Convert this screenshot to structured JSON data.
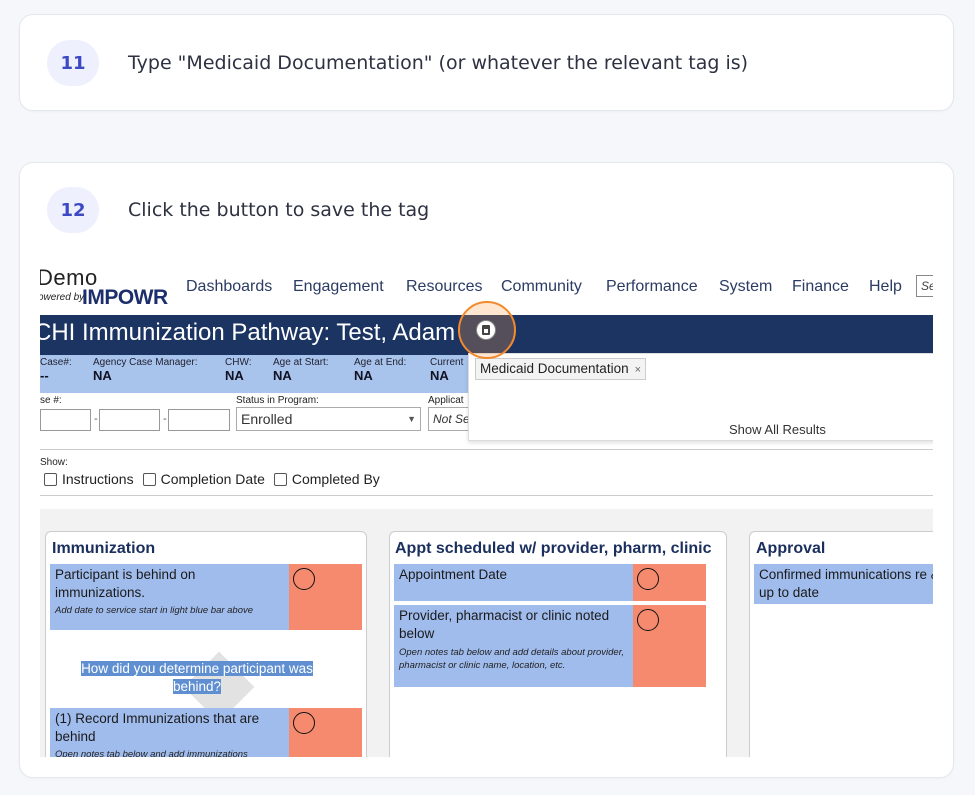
{
  "steps": [
    {
      "number": "11",
      "text": "Type \"Medicaid Documentation\" (or whatever the relevant tag is)"
    },
    {
      "number": "12",
      "text": "Click the button to save the tag"
    }
  ],
  "app": {
    "logo_demo": "Demo",
    "logo_powered": "owered by",
    "logo_brand": "IMPOWR",
    "nav": [
      "Dashboards",
      "Engagement",
      "Resources",
      "Community",
      "Performance",
      "System",
      "Finance",
      "Help"
    ],
    "search_placeholder": "Se",
    "page_title": "CHI Immunization Pathway: Test, Adam",
    "info": [
      {
        "label": "Case#:",
        "value": "--"
      },
      {
        "label": "Agency Case Manager:",
        "value": "NA"
      },
      {
        "label": "CHW:",
        "value": "NA"
      },
      {
        "label": "Age at Start:",
        "value": "NA"
      },
      {
        "label": "Age at End:",
        "value": "NA"
      },
      {
        "label": "Current",
        "value": "NA"
      }
    ],
    "case_label": "se #:",
    "status_label": "Status in Program:",
    "status_value": "Enrolled",
    "applic_label": "Applicat",
    "applic_value": "Not Se",
    "show_label": "Show:",
    "checkboxes": [
      "Instructions",
      "Completion Date",
      "Completed By"
    ],
    "columns": [
      {
        "title": "Immunization",
        "tasks": [
          {
            "main": "Participant is behind on immunizations.",
            "sub": "Add date to service start in light blue bar above"
          },
          {
            "main": "(1) Record Immunizations that are behind",
            "sub": "Open notes tab below and add immunizations"
          }
        ],
        "question": "How did you determine participant was behind?"
      },
      {
        "title": "Appt scheduled w/ provider, pharm, clinic",
        "tasks": [
          {
            "main": "Appointment Date",
            "sub": ""
          },
          {
            "main": "Provider, pharmacist or clinic noted below",
            "sub": "Open notes tab below and add details about provider, pharmacist or clinic name, location, etc."
          }
        ]
      },
      {
        "title": "Approval",
        "tasks": [
          {
            "main": "Confirmed immunications re & up to date",
            "sub": ""
          }
        ]
      }
    ],
    "tag_value": "Medicaid Documentation",
    "tag_remove": "×",
    "show_all_results": "Show All Results"
  }
}
